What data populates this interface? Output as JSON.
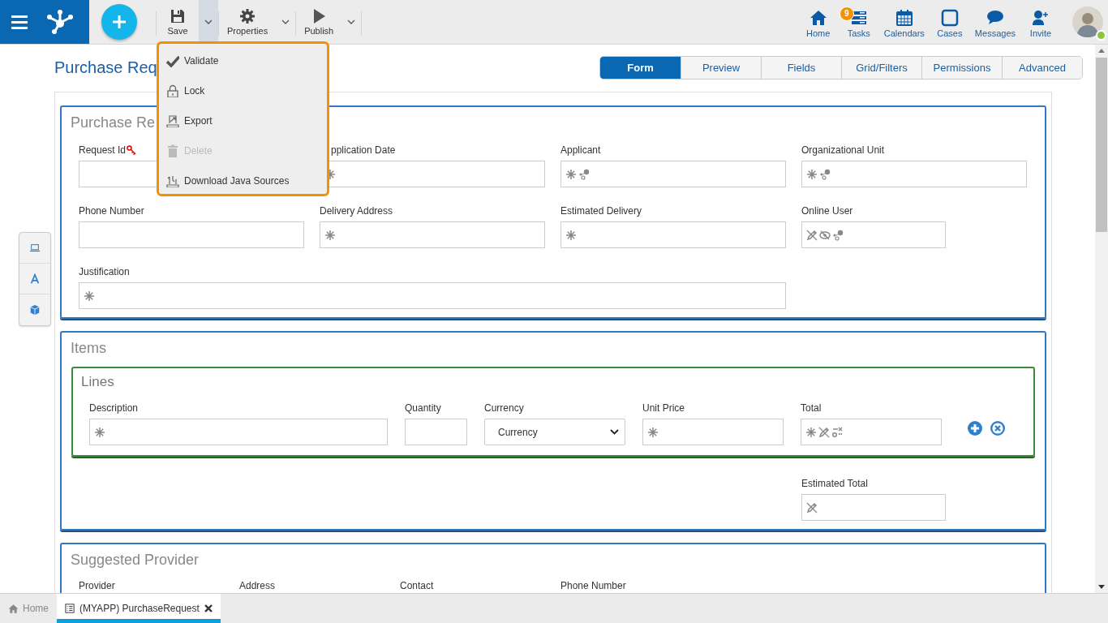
{
  "topbar": {
    "toolbar": [
      {
        "label": "Save",
        "menu_open": true
      },
      {
        "label": "Properties",
        "menu_open": false
      },
      {
        "label": "Publish",
        "menu_open": false
      }
    ],
    "nav": [
      {
        "label": "Home"
      },
      {
        "label": "Tasks",
        "badge": "9"
      },
      {
        "label": "Calendars"
      },
      {
        "label": "Cases"
      },
      {
        "label": "Messages"
      },
      {
        "label": "Invite"
      }
    ],
    "user": {
      "online": true
    }
  },
  "menu": {
    "items": [
      {
        "label": "Validate",
        "disabled": false
      },
      {
        "label": "Lock",
        "disabled": false
      },
      {
        "label": "Export",
        "disabled": false
      },
      {
        "label": "Delete",
        "disabled": true
      },
      {
        "label": "Download Java Sources",
        "disabled": false
      }
    ]
  },
  "page": {
    "title": "Purchase Req",
    "tabs": [
      {
        "label": "Form",
        "selected": true
      },
      {
        "label": "Preview",
        "selected": false
      },
      {
        "label": "Fields",
        "selected": false
      },
      {
        "label": "Grid/Filters",
        "selected": false
      },
      {
        "label": "Permissions",
        "selected": false
      },
      {
        "label": "Advanced",
        "selected": false
      }
    ]
  },
  "sections": [
    {
      "kind": "fields",
      "title": "Purchase Re",
      "rows": [
        [
          {
            "label": "Request Id",
            "kind": "text",
            "key": true
          },
          {
            "label": "pplication Date",
            "kind": "text",
            "required": true
          },
          {
            "label": "Applicant",
            "kind": "text",
            "required": true,
            "dependency": true
          },
          {
            "label": "Organizational Unit",
            "kind": "text",
            "required": true,
            "dependency": true
          }
        ],
        [
          {
            "label": "Phone Number",
            "kind": "text"
          },
          {
            "label": "Delivery Address",
            "kind": "text",
            "required": true
          },
          {
            "label": "Estimated Delivery",
            "kind": "text",
            "required": true
          },
          {
            "label": "Online User",
            "kind": "narrow",
            "calculated": true,
            "hidden": true,
            "dependency": true
          }
        ],
        [
          {
            "label": "Justification",
            "kind": "memo",
            "required": true
          }
        ]
      ]
    },
    {
      "kind": "grid",
      "title": "Items",
      "grid": {
        "title": "Lines",
        "columns": [
          {
            "label": "Description",
            "kind": "text",
            "required": true
          },
          {
            "label": "Quantity",
            "kind": "text"
          },
          {
            "label": "Currency",
            "kind": "select",
            "value": "Currency"
          },
          {
            "label": "Unit Price",
            "kind": "text",
            "required": true
          },
          {
            "label": "Total",
            "kind": "text",
            "required": true,
            "calculated": true,
            "formula": true
          }
        ]
      },
      "footer": [
        {
          "label": "Estimated Total",
          "kind": "narrow",
          "calculated": true
        }
      ]
    },
    {
      "kind": "cut",
      "title": "Suggested Provider",
      "labels": [
        "Provider",
        "Address",
        "Contact",
        "Phone Number"
      ]
    }
  ],
  "open_tabs": [
    {
      "label": "Home",
      "selected": false,
      "closable": false
    },
    {
      "label": "(MYAPP) PurchaseRequest",
      "selected": true,
      "closable": true
    }
  ]
}
